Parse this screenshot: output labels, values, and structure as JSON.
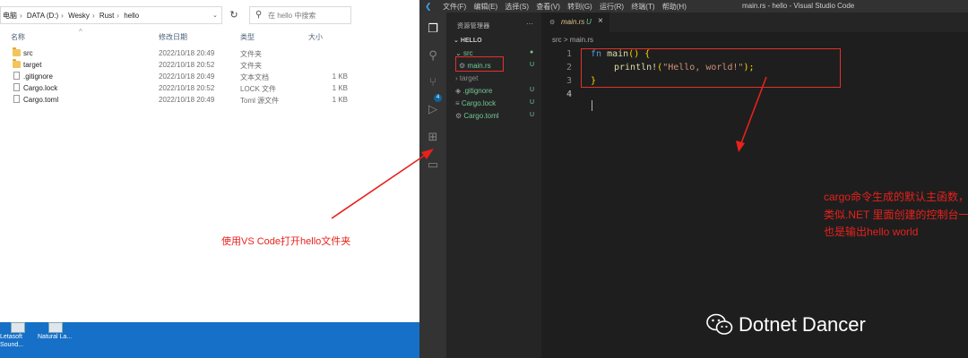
{
  "explorer": {
    "breadcrumbs": [
      "电脑",
      "DATA (D:)",
      "Wesky",
      "Rust",
      "hello"
    ],
    "search_placeholder": "在 hello 中搜索",
    "columns": {
      "name": "名称",
      "date": "修改日期",
      "type": "类型",
      "size": "大小"
    },
    "files": [
      {
        "name": "src",
        "date": "2022/10/18 20:49",
        "type": "文件夹",
        "size": "",
        "icon": "folder-icon"
      },
      {
        "name": "target",
        "date": "2022/10/18 20:52",
        "type": "文件夹",
        "size": "",
        "icon": "folder-icon"
      },
      {
        "name": ".gitignore",
        "date": "2022/10/18 20:49",
        "type": "文本文档",
        "size": "1 KB",
        "icon": "text-file-icon"
      },
      {
        "name": "Cargo.lock",
        "date": "2022/10/18 20:52",
        "type": "LOCK 文件",
        "size": "1 KB",
        "icon": "file-icon"
      },
      {
        "name": "Cargo.toml",
        "date": "2022/10/18 20:49",
        "type": "Toml 源文件",
        "size": "1 KB",
        "icon": "file-icon"
      }
    ],
    "annotation": "使用VS Code打开hello文件夹"
  },
  "desktop": {
    "items": [
      "Letasoft Sound...",
      "Natural La..."
    ]
  },
  "vscode": {
    "menu": [
      "文件(F)",
      "编辑(E)",
      "选择(S)",
      "查看(V)",
      "转到(G)",
      "运行(R)",
      "终端(T)",
      "帮助(H)"
    ],
    "window_title": "main.rs - hello - Visual Studio Code",
    "scm_badge": "4",
    "sidebar": {
      "title": "资源管理器",
      "more": "···",
      "folder": "HELLO",
      "items": [
        {
          "label": "src",
          "status": "",
          "color": "#73c991"
        },
        {
          "label": "main.rs",
          "status": "U",
          "color": "#73c991"
        },
        {
          "label": "target",
          "status": "",
          "color": "#8c8c8c"
        },
        {
          "label": ".gitignore",
          "status": "U",
          "color": "#73c991"
        },
        {
          "label": "Cargo.lock",
          "status": "U",
          "color": "#73c991"
        },
        {
          "label": "Cargo.toml",
          "status": "U",
          "color": "#73c991"
        }
      ]
    },
    "tab": {
      "name": "main.rs",
      "status": "U",
      "close": "×"
    },
    "breadcrumb": "src > main.rs",
    "code": {
      "line_numbers": [
        "1",
        "2",
        "3",
        "4"
      ],
      "l1_kw": "fn",
      "l1_fn": "main",
      "l1_rest": "() {",
      "l2_fn": "println!",
      "l2_open": "(",
      "l2_str": "\"Hello, world!\"",
      "l2_close": ");",
      "l3": "}"
    },
    "annotation": [
      "cargo命令生成的默认主函数，输出hello world",
      "类似.NET 里面创建的控制台一样，",
      "也是输出hello world"
    ],
    "brand": "Dotnet Dancer"
  },
  "colors": {
    "annotation_red": "#e8211c",
    "vscode_blue": "#3aa3f2",
    "scm_green": "#73c991"
  }
}
